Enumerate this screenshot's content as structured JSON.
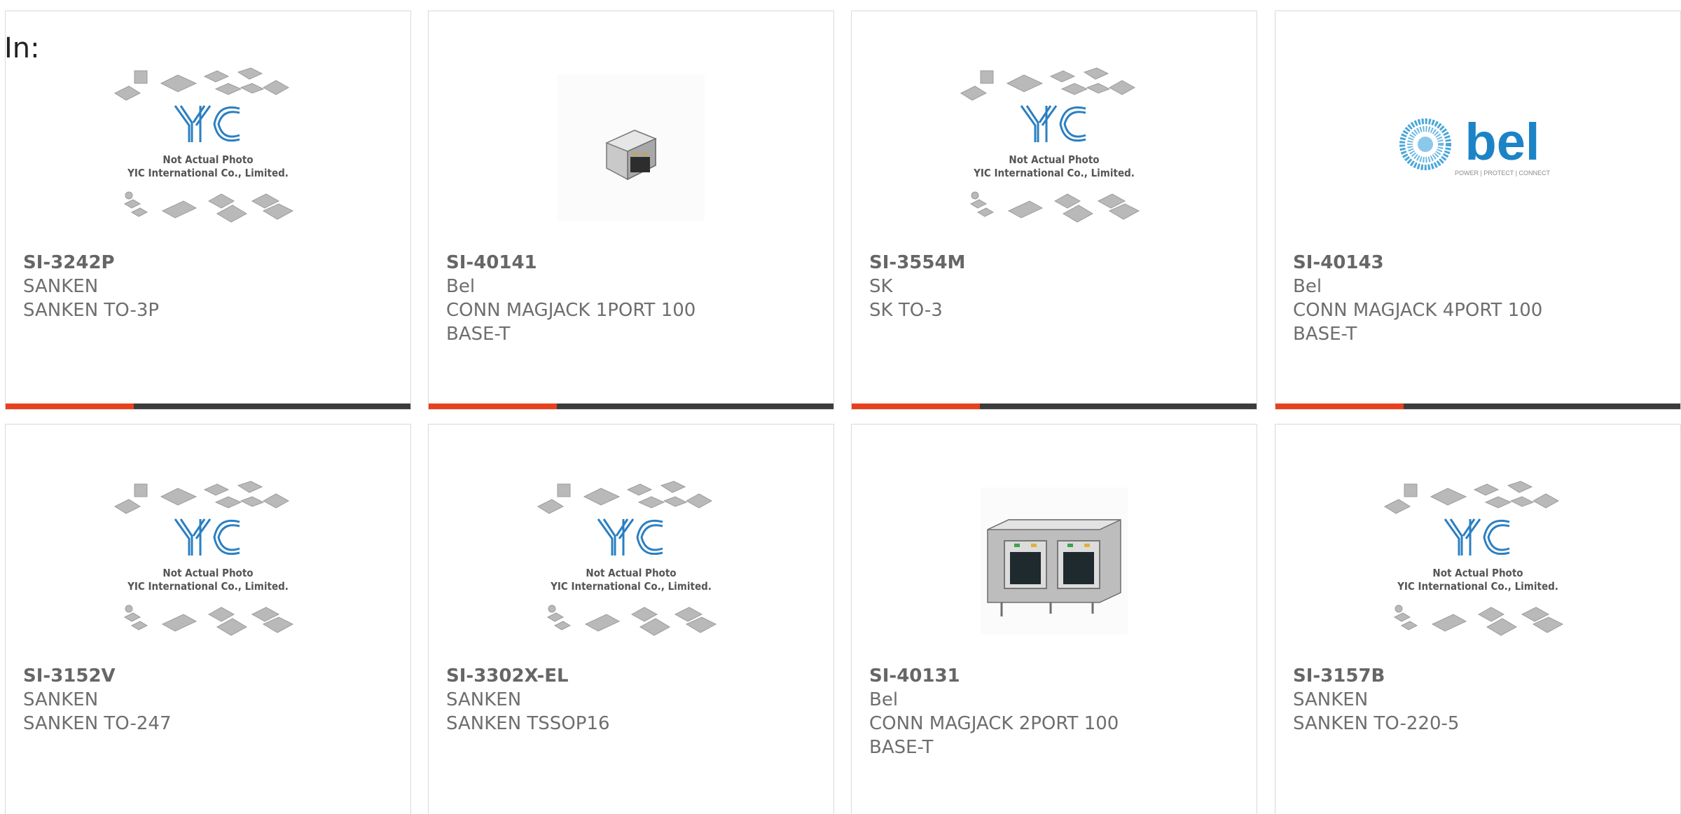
{
  "header": {
    "in_label": "In:"
  },
  "colors": {
    "accent": "#e8401c",
    "bar": "#3c3c3c",
    "text": "#6e6e6e",
    "yic_blue": "#2b7fc1",
    "bel_blue": "#1c84c6"
  },
  "placeholder": {
    "line1": "Not Actual Photo",
    "line2": "YIC International Co., Limited."
  },
  "bel_logo": {
    "wordmark": "bel",
    "tagline": "POWER | PROTECT | CONNECT"
  },
  "products": [
    {
      "part": "SI-3242P",
      "maker": "SANKEN",
      "desc": "SANKEN TO-3P",
      "image": "yic-placeholder"
    },
    {
      "part": "SI-40141",
      "maker": "Bel",
      "desc": "CONN MAGJACK 1PORT 100 BASE-T",
      "image": "magjack-1port"
    },
    {
      "part": "SI-3554M",
      "maker": "SK",
      "desc": "SK TO-3",
      "image": "yic-placeholder"
    },
    {
      "part": "SI-40143",
      "maker": "Bel",
      "desc": "CONN MAGJACK 4PORT 100 BASE-T",
      "image": "bel-logo"
    },
    {
      "part": "SI-3152V",
      "maker": "SANKEN",
      "desc": "SANKEN TO-247",
      "image": "yic-placeholder"
    },
    {
      "part": "SI-3302X-EL",
      "maker": "SANKEN",
      "desc": "SANKEN TSSOP16",
      "image": "yic-placeholder"
    },
    {
      "part": "SI-40131",
      "maker": "Bel",
      "desc": "CONN MAGJACK 2PORT 100 BASE-T",
      "image": "magjack-2port"
    },
    {
      "part": "SI-3157B",
      "maker": "SANKEN",
      "desc": "SANKEN TO-220-5",
      "image": "yic-placeholder"
    }
  ]
}
